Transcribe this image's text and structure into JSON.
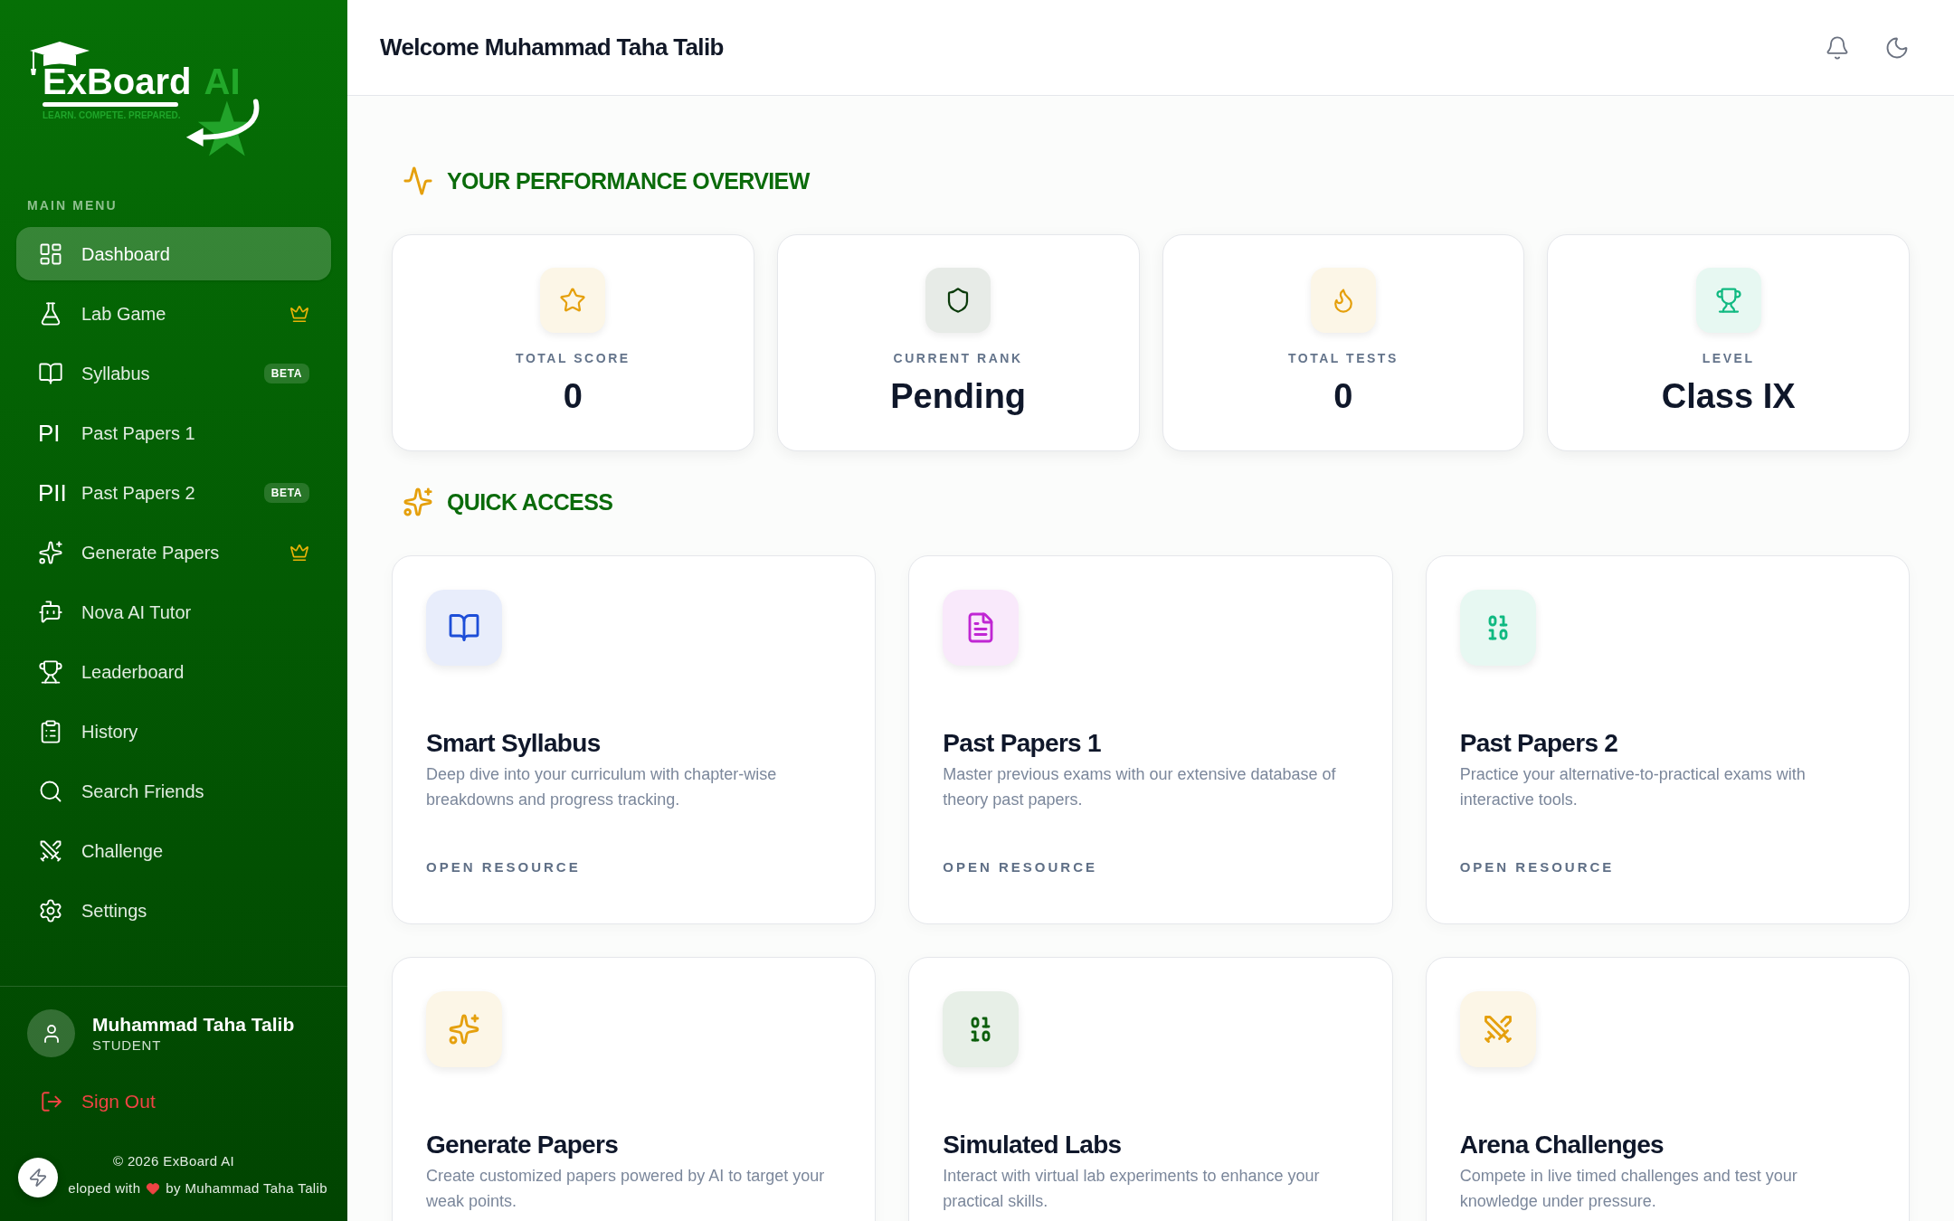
{
  "sidebar": {
    "logo": {
      "name": "ExBoard",
      "suffix": "AI",
      "tagline": "LEARN. COMPETE. PREPARED."
    },
    "menu_label": "MAIN MENU",
    "items": [
      {
        "label": "Dashboard",
        "selected": true,
        "premium": false
      },
      {
        "label": "Lab Game",
        "selected": false,
        "premium": true
      },
      {
        "label": "Syllabus",
        "selected": false,
        "premium": false,
        "badge": "BETA"
      },
      {
        "label": "Past Papers 1",
        "selected": false,
        "premium": false,
        "glyph": "PI"
      },
      {
        "label": "Past Papers 2",
        "selected": false,
        "premium": false,
        "glyph": "PII",
        "badge": "BETA"
      },
      {
        "label": "Generate Papers",
        "selected": false,
        "premium": true
      },
      {
        "label": "Nova AI Tutor",
        "selected": false,
        "premium": false
      },
      {
        "label": "Leaderboard",
        "selected": false,
        "premium": false
      },
      {
        "label": "History",
        "selected": false,
        "premium": false
      },
      {
        "label": "Search Friends",
        "selected": false,
        "premium": false
      },
      {
        "label": "Challenge",
        "selected": false,
        "premium": false
      },
      {
        "label": "Settings",
        "selected": false,
        "premium": false
      }
    ],
    "user": {
      "name": "Muhammad Taha Talib",
      "role": "STUDENT"
    },
    "sign_out": "Sign Out",
    "footer": {
      "copyright": "© 2026 ExBoard AI",
      "credit_start": "eloped with",
      "credit_end": "by Muhammad Taha Talib"
    }
  },
  "header": {
    "title": "Welcome Muhammad Taha Talib"
  },
  "performance": {
    "heading": "YOUR PERFORMANCE OVERVIEW",
    "stats": [
      {
        "label": "TOTAL SCORE",
        "value": "0",
        "color": "#e5a00d"
      },
      {
        "label": "CURRENT RANK",
        "value": "Pending",
        "color": "#0a3a0a"
      },
      {
        "label": "TOTAL TESTS",
        "value": "0",
        "color": "#e5a00d"
      },
      {
        "label": "LEVEL",
        "value": "Class IX",
        "color": "#10b981"
      }
    ]
  },
  "quick_access": {
    "heading": "QUICK ACCESS",
    "cards": [
      {
        "title": "Smart Syllabus",
        "description": "Deep dive into your curriculum with chapter-wise breakdowns and progress tracking.",
        "link": "OPEN RESOURCE",
        "color": "#1d4ed8"
      },
      {
        "title": "Past Papers 1",
        "description": "Master previous exams with our extensive database of theory past papers.",
        "link": "OPEN RESOURCE",
        "color": "#c026d3"
      },
      {
        "title": "Past Papers 2",
        "description": "Practice your alternative-to-practical exams with interactive tools.",
        "link": "OPEN RESOURCE",
        "color": "#10b981"
      },
      {
        "title": "Generate Papers",
        "description": "Create customized papers powered by AI to target your weak points.",
        "color": "#e5a00d"
      },
      {
        "title": "Simulated Labs",
        "description": "Interact with virtual lab experiments to enhance your practical skills.",
        "color": "#0b5e0b"
      },
      {
        "title": "Arena Challenges",
        "description": "Compete in live timed challenges and test your knowledge under pressure.",
        "color": "#e5a00d"
      }
    ]
  }
}
